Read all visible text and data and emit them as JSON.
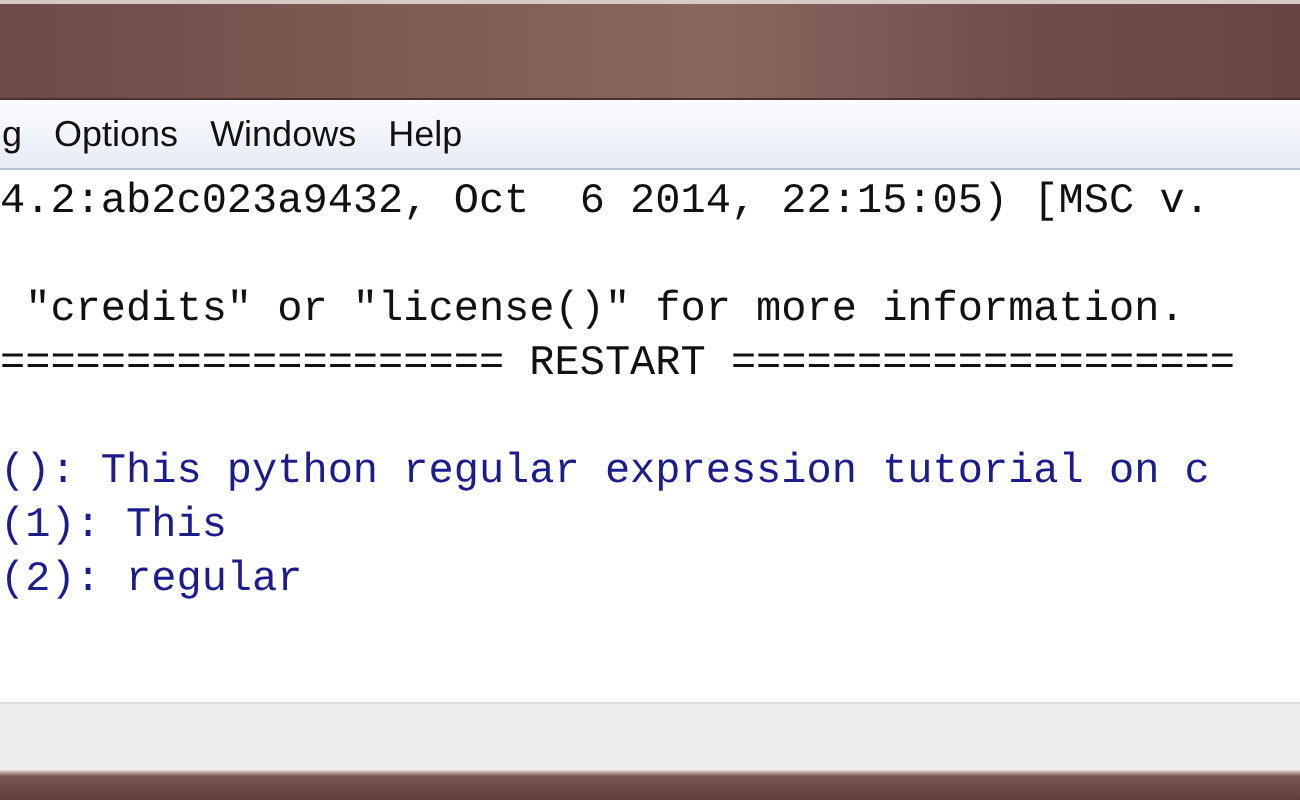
{
  "menu_bar": {
    "items": [
      "g",
      "Options",
      "Windows",
      "Help"
    ]
  },
  "shell": {
    "lines": [
      {
        "kind": "output",
        "text": "4.2:ab2c023a9432, Oct  6 2014, 22:15:05) [MSC v."
      },
      {
        "kind": "blank"
      },
      {
        "kind": "output",
        "text": " \"credits\" or \"license()\" for more information."
      },
      {
        "kind": "output",
        "text": "==================== RESTART ===================="
      },
      {
        "kind": "blank"
      },
      {
        "kind": "stdout",
        "text": "(): This python regular expression tutorial on c"
      },
      {
        "kind": "stdout",
        "text": "(1): This"
      },
      {
        "kind": "stdout",
        "text": "(2): regular"
      }
    ]
  }
}
